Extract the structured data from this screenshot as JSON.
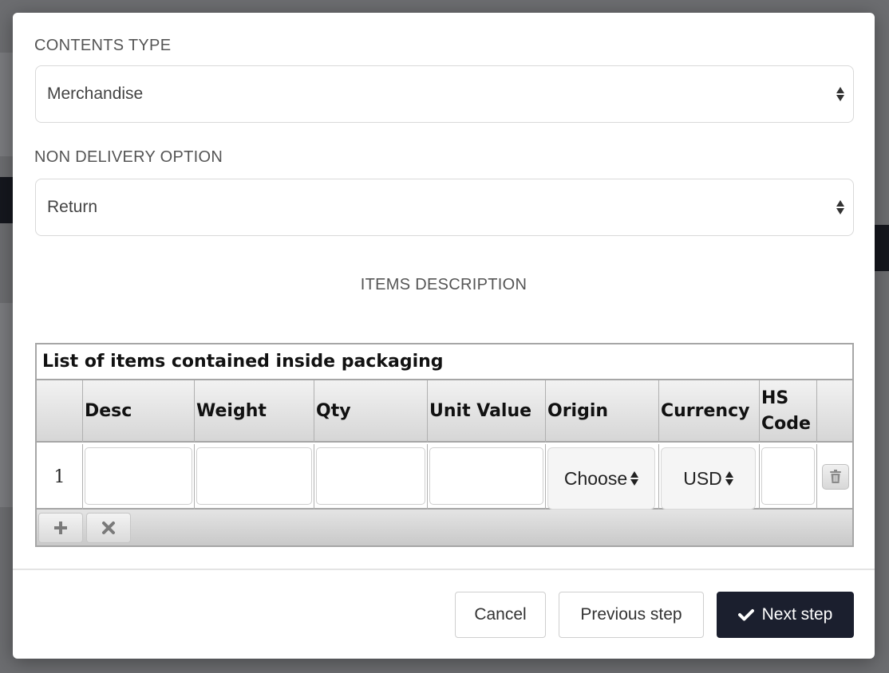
{
  "contents_type": {
    "label": "CONTENTS TYPE",
    "selected": "Merchandise"
  },
  "non_delivery": {
    "label": "NON DELIVERY OPTION",
    "selected": "Return"
  },
  "items": {
    "section_title": "ITEMS DESCRIPTION",
    "caption": "List of items contained inside packaging",
    "columns": [
      "Desc",
      "Weight",
      "Qty",
      "Unit Value",
      "Origin",
      "Currency",
      "HS Code"
    ],
    "rows": [
      {
        "number": "1",
        "desc": "",
        "weight": "",
        "qty": "",
        "unit_value": "",
        "origin": "Choose",
        "currency": "USD",
        "hs_code": ""
      }
    ],
    "add_icon": "plus-icon",
    "remove_icon": "cross-icon",
    "delete_icon": "trash-icon"
  },
  "footer": {
    "cancel_label": "Cancel",
    "previous_label": "Previous step",
    "next_label": "Next step",
    "next_icon": "checkmark-icon"
  },
  "colors": {
    "primary_button": "#1b1f2e",
    "overlay": "#5f6062"
  }
}
